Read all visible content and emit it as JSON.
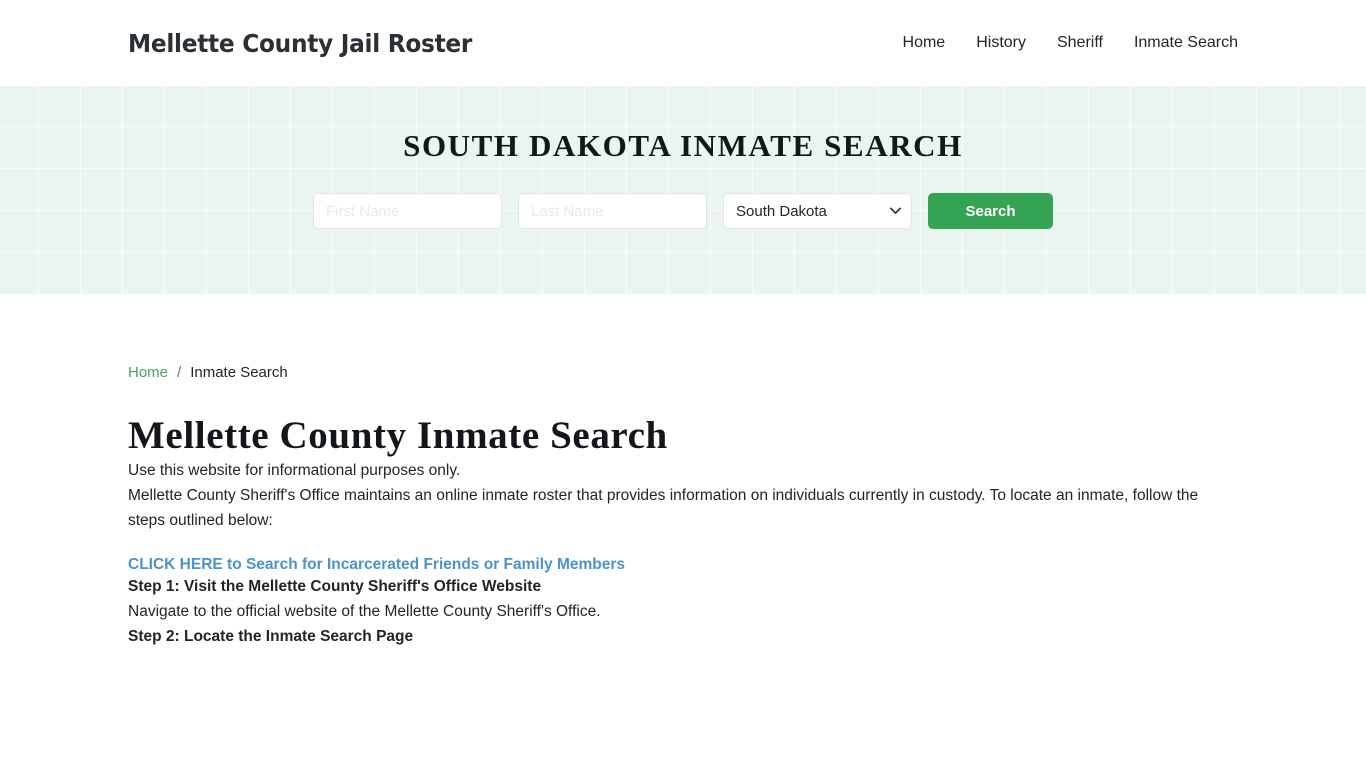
{
  "header": {
    "brand": "Mellette County Jail Roster",
    "nav": [
      {
        "label": "Home"
      },
      {
        "label": "History"
      },
      {
        "label": "Sheriff"
      },
      {
        "label": "Inmate Search"
      }
    ]
  },
  "hero": {
    "title": "SOUTH DAKOTA INMATE SEARCH",
    "first_name_placeholder": "First Name",
    "first_name_value": "",
    "last_name_placeholder": "Last Name",
    "last_name_value": "",
    "state_selected": "South Dakota",
    "search_button": "Search",
    "accent_color": "#34a353",
    "background_color": "#e9f5ee"
  },
  "breadcrumb": {
    "home": "Home",
    "separator": "/",
    "current": "Inmate Search",
    "link_color": "#4a9e68"
  },
  "main": {
    "page_title": "Mellette County Inmate Search",
    "intro": "Use this website for informational purposes only.",
    "roster_paragraph": "Mellette County Sheriff's Office maintains an online inmate roster that provides information on individuals currently in custody. To locate an inmate, follow the steps outlined below:",
    "cta_link": "CLICK HERE to Search for Incarcerated Friends or Family Members",
    "cta_color": "#4b93c9",
    "step1_heading": "Step 1: Visit the Mellette County Sheriff's Office Website",
    "step1_text": "Navigate to the official website of the Mellette County Sheriff's Office.",
    "step2_heading": "Step 2: Locate the Inmate Search Page"
  }
}
